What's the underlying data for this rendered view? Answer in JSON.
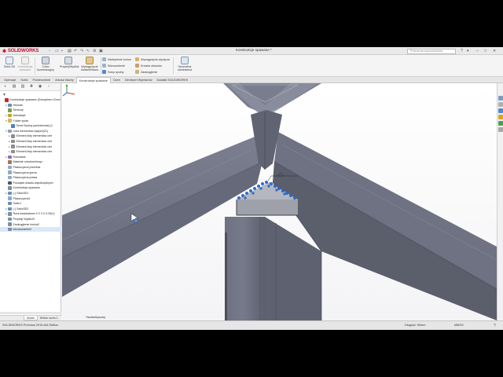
{
  "app": {
    "brand": "SOLIDWORKS",
    "document_title": "Konstrukcje spawane *",
    "search_placeholder": "Polecenia wyszukiwania"
  },
  "command_manager": {
    "big_buttons": [
      {
        "label": "Szkic 3D",
        "icon": "sketch3d-icon"
      },
      {
        "label": "Konstrukcja spawana",
        "icon": "weldment-icon"
      },
      {
        "label": "Człon konstrukcyjny",
        "icon": "structural-member-icon"
      },
      {
        "label": "Przytnij/Wydłuż",
        "icon": "trim-extend-icon"
      },
      {
        "label": "Wyciągnięcie dodanie/baza",
        "icon": "extruded-boss-icon"
      }
    ],
    "small_col1": [
      "Zaślepienie końca",
      "Wzmocnienie",
      "Szwy spoiny"
    ],
    "small_col2": [
      "Wyciągnięcie wycięcia",
      "Kreator otworów",
      "Zaokrąglenie"
    ],
    "last_button": {
      "label": "Geometria odniesienia",
      "icon": "reference-geometry-icon"
    }
  },
  "tabs": [
    "Operacje",
    "Szkic",
    "Powierzchnie",
    "Arkusz blachy",
    "Konstrukcje spawane",
    "Oceń",
    "DimXpert Wymiarów",
    "Dodatki SOLIDWORKS"
  ],
  "active_tab": 4,
  "tree": [
    {
      "label": "Konstrukcje spawane  (Domyślne<<Dom",
      "indent": 0,
      "exp": "",
      "color": "#c62828"
    },
    {
      "label": "Historia",
      "indent": 1,
      "exp": "▸",
      "color": "#6b8fb5"
    },
    {
      "label": "Sensory",
      "indent": 1,
      "exp": "",
      "color": "#7a9c5a"
    },
    {
      "label": "Adnotacje",
      "indent": 1,
      "exp": "▸",
      "color": "#c9a227"
    },
    {
      "label": "Folder spoin",
      "indent": 1,
      "exp": "▾",
      "color": "#d7b85b"
    },
    {
      "label": "Szew Spoiny pachwinowej (1",
      "indent": 2,
      "exp": "",
      "color": "#4f7fc1"
    },
    {
      "label": "Lista elementów ciętych(21)",
      "indent": 1,
      "exp": "▾",
      "color": "#8da0b5"
    },
    {
      "label": "Element listy elementów ciet",
      "indent": 2,
      "exp": "▸",
      "color": "#8d8d8d"
    },
    {
      "label": "Element listy elementów ciet",
      "indent": 2,
      "exp": "▸",
      "color": "#8d8d8d"
    },
    {
      "label": "Element listy elementów ciet",
      "indent": 2,
      "exp": "▸",
      "color": "#8d8d8d"
    },
    {
      "label": "Element listy elementów ciet",
      "indent": 2,
      "exp": "▸",
      "color": "#8d8d8d"
    },
    {
      "label": "Równania",
      "indent": 1,
      "exp": "▸",
      "color": "#8d6fb5"
    },
    {
      "label": "Materiał <nieokreślony>",
      "indent": 1,
      "exp": "",
      "color": "#9c7b5a"
    },
    {
      "label": "Płaszczyzna przednia",
      "indent": 1,
      "exp": "",
      "color": "#8fa9c9"
    },
    {
      "label": "Płaszczyzna górna",
      "indent": 1,
      "exp": "",
      "color": "#8fa9c9"
    },
    {
      "label": "Płaszczyzna prawa",
      "indent": 1,
      "exp": "",
      "color": "#8fa9c9"
    },
    {
      "label": "Początek układu współrzędnych",
      "indent": 1,
      "exp": "",
      "color": "#555555"
    },
    {
      "label": "Konstrukcja spawana",
      "indent": 1,
      "exp": "",
      "color": "#7d8fa5"
    },
    {
      "label": "(-) Szkic3D1",
      "indent": 1,
      "exp": "▸",
      "color": "#6b8fb5"
    },
    {
      "label": "Płaszczyzna1",
      "indent": 1,
      "exp": "",
      "color": "#8fa9c9"
    },
    {
      "label": "Szkic1",
      "indent": 1,
      "exp": "",
      "color": "#6b8fb5"
    },
    {
      "label": "(-) Szkic3D2",
      "indent": 1,
      "exp": "▸",
      "color": "#6b8fb5"
    },
    {
      "label": "Rura kwadratowa 3 X 3 X 0.25(1)",
      "indent": 1,
      "exp": "▸",
      "color": "#7d8fa5"
    },
    {
      "label": "Przytnij/ Wydłuż3",
      "indent": 1,
      "exp": "",
      "color": "#7d8fa5"
    },
    {
      "label": "Zaokrąglenie końca2",
      "indent": 1,
      "exp": "",
      "color": "#7d8fa5"
    },
    {
      "label": "Wzmocnienie2",
      "indent": 1,
      "exp": "",
      "color": "#7d8fa5"
    }
  ],
  "panel_bottom_tabs": [
    "Model",
    "Widok ruchu 1"
  ],
  "viewport": {
    "view_label": "*Izometryczny"
  },
  "status": {
    "left": "SOLIDWORKS Premium 2016 x64 Edition",
    "length": "Długość: 50mm",
    "units": "MMGS",
    "help": "?"
  },
  "colors": {
    "steel_face": "#6f7383",
    "steel_face_light": "#7d8192",
    "steel_dark": "#4b4e5a",
    "gusset": "#a3a6ae",
    "weld_bead": "#2f6fd6",
    "selection": "#d9e8f7"
  }
}
